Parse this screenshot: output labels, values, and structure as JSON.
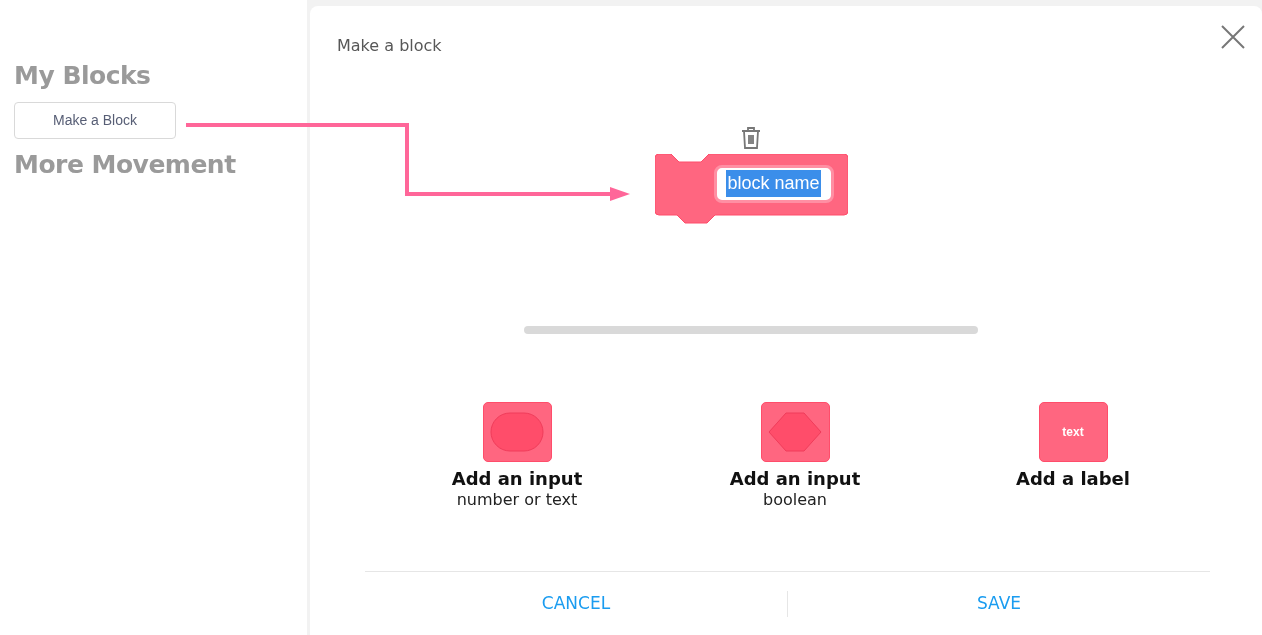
{
  "palette": {
    "headings": [
      "My Blocks",
      "More Movement"
    ],
    "button": "Make a Block"
  },
  "dialog": {
    "title": "Make a block",
    "block": {
      "name_value": "block name",
      "name_selected": true
    },
    "options": [
      {
        "kind": "round",
        "title": "Add an input",
        "subtitle": "number or text"
      },
      {
        "kind": "hexagon",
        "title": "Add an input",
        "subtitle": "boolean"
      },
      {
        "kind": "text",
        "title": "Add a label",
        "icon_text": "text"
      }
    ],
    "buttons": [
      "CANCEL",
      "SAVE"
    ]
  }
}
